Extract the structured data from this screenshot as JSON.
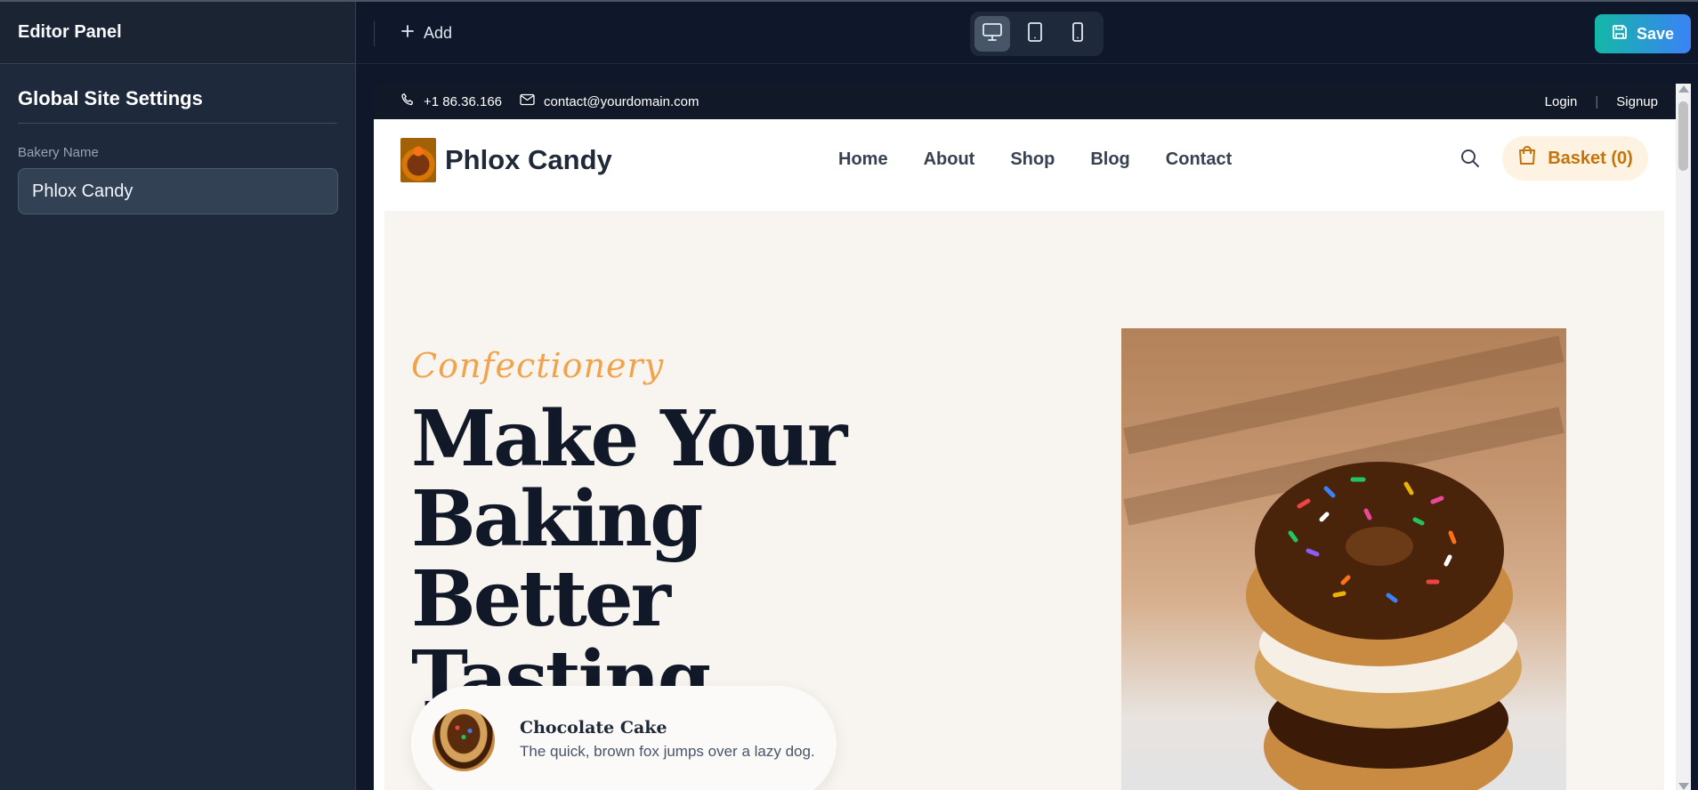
{
  "sidebar": {
    "title": "Editor Panel",
    "section_title": "Global Site Settings",
    "bakery_name_label": "Bakery Name",
    "bakery_name_value": "Phlox Candy"
  },
  "toolbar": {
    "add_label": "Add",
    "devices": [
      "desktop",
      "tablet",
      "mobile"
    ],
    "active_device": "desktop",
    "save_label": "Save"
  },
  "site": {
    "topbar": {
      "phone": "+1 86.36.166",
      "email": "contact@yourdomain.com",
      "login": "Login",
      "separator": "|",
      "signup": "Signup"
    },
    "header": {
      "logo_text": "Phlox Candy",
      "nav": [
        "Home",
        "About",
        "Shop",
        "Blog",
        "Contact"
      ],
      "basket_label": "Basket (0)"
    },
    "hero": {
      "tagline": "Confectionery",
      "title_line1": "Make Your",
      "title_line2": "Baking Better",
      "title_line3": "Tasting",
      "card_title": "Chocolate Cake",
      "card_desc": "The quick, brown fox jumps over a lazy dog."
    }
  },
  "colors": {
    "accent_orange": "#f0a34b",
    "save_gradient_start": "#14b8a6",
    "save_gradient_end": "#3b82f6",
    "hero_bg": "#f8f5f0"
  }
}
